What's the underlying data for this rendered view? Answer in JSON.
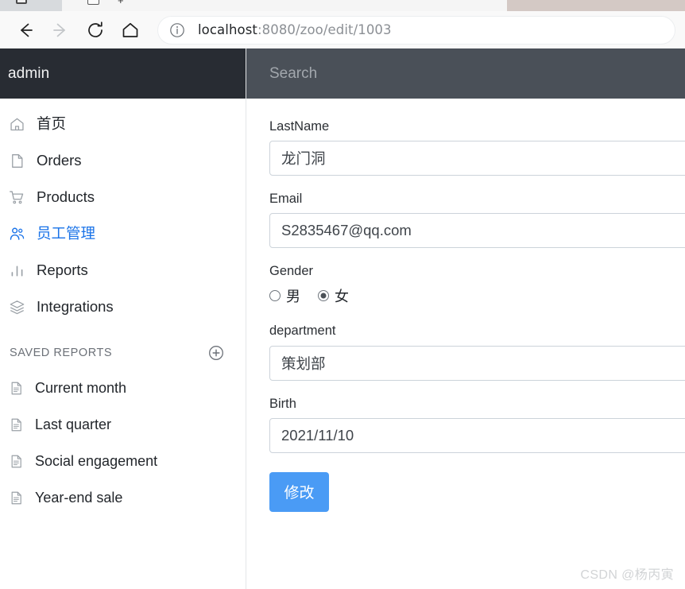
{
  "browser": {
    "url_host": "localhost",
    "url_path": ":8080/zoo/edit/1003",
    "back_icon": "arrow-left-icon",
    "forward_icon": "arrow-right-icon",
    "reload_icon": "reload-icon",
    "home_icon": "home-icon",
    "info_icon": "info-circle-icon"
  },
  "sidebar": {
    "brand": "admin",
    "items": [
      {
        "label": "首页",
        "icon": "home-icon",
        "active": false
      },
      {
        "label": "Orders",
        "icon": "document-icon",
        "active": false
      },
      {
        "label": "Products",
        "icon": "shopping-cart-icon",
        "active": false
      },
      {
        "label": "员工管理",
        "icon": "users-icon",
        "active": true
      },
      {
        "label": "Reports",
        "icon": "bar-chart-icon",
        "active": false
      },
      {
        "label": "Integrations",
        "icon": "layers-icon",
        "active": false
      }
    ],
    "saved_reports": {
      "title": "SAVED REPORTS",
      "add_icon": "plus-circle-icon",
      "items": [
        {
          "label": "Current month",
          "icon": "file-text-icon"
        },
        {
          "label": "Last quarter",
          "icon": "file-text-icon"
        },
        {
          "label": "Social engagement",
          "icon": "file-text-icon"
        },
        {
          "label": "Year-end sale",
          "icon": "file-text-icon"
        }
      ]
    }
  },
  "topbar": {
    "search_placeholder": "Search"
  },
  "form": {
    "fields": [
      {
        "label": "LastName",
        "value": "龙门洞"
      },
      {
        "label": "Email",
        "value": "S2835467@qq.com"
      }
    ],
    "gender": {
      "label": "Gender",
      "options": [
        {
          "label": "男",
          "checked": false
        },
        {
          "label": "女",
          "checked": true
        }
      ]
    },
    "department": {
      "label": "department",
      "value": "策划部"
    },
    "birth": {
      "label": "Birth",
      "value": "2021/11/10"
    },
    "submit_label": "修改"
  },
  "watermark": "CSDN @杨丙寅",
  "colors": {
    "accent_blue": "#1a73e8",
    "button_blue": "#4a9bf5",
    "sidebar_brand_bg": "#282c33",
    "topbar_bg": "#4a5058"
  }
}
